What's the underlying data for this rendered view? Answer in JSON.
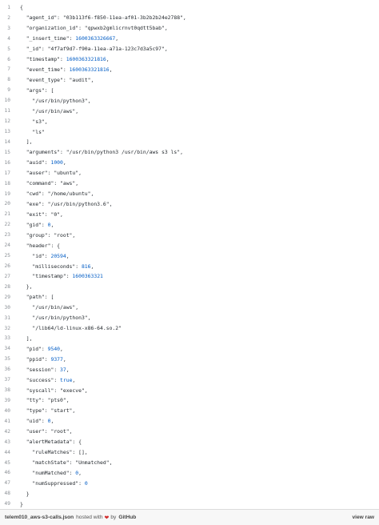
{
  "lines": [
    {
      "n": "1",
      "text": "{"
    },
    {
      "n": "2",
      "text": "  \"agent_id\": \"03b113f6-f850-11ea-af01-3b2b2b24e2788\","
    },
    {
      "n": "3",
      "text": "  \"organization_id\": \"qpwxb2gmlicrnvt0qdtt5bab\","
    },
    {
      "n": "4",
      "text": "  \"_insert_time\": 1600363326667,"
    },
    {
      "n": "5",
      "text": "  \"_id\": \"4f7af9d7-f90a-11ea-a71a-123c7d3a5c97\","
    },
    {
      "n": "6",
      "text": "  \"timestamp\": 1600363321816,"
    },
    {
      "n": "7",
      "text": "  \"event_time\": 1600363321816,"
    },
    {
      "n": "8",
      "text": "  \"event_type\": \"audit\","
    },
    {
      "n": "9",
      "text": "  \"args\": ["
    },
    {
      "n": "10",
      "text": "    \"/usr/bin/python3\","
    },
    {
      "n": "11",
      "text": "    \"/usr/bin/aws\","
    },
    {
      "n": "12",
      "text": "    \"s3\","
    },
    {
      "n": "13",
      "text": "    \"ls\""
    },
    {
      "n": "14",
      "text": "  ],"
    },
    {
      "n": "15",
      "text": "  \"arguments\": \"/usr/bin/python3 /usr/bin/aws s3 ls\","
    },
    {
      "n": "16",
      "text": "  \"auid\": 1000,"
    },
    {
      "n": "17",
      "text": "  \"auser\": \"ubuntu\","
    },
    {
      "n": "18",
      "text": "  \"command\": \"aws\","
    },
    {
      "n": "19",
      "text": "  \"cwd\": \"/home/ubuntu\","
    },
    {
      "n": "20",
      "text": "  \"exe\": \"/usr/bin/python3.6\","
    },
    {
      "n": "21",
      "text": "  \"exit\": \"0\","
    },
    {
      "n": "22",
      "text": "  \"gid\": 0,"
    },
    {
      "n": "23",
      "text": "  \"group\": \"root\","
    },
    {
      "n": "24",
      "text": "  \"header\": {"
    },
    {
      "n": "25",
      "text": "    \"id\": 20594,"
    },
    {
      "n": "26",
      "text": "    \"milliseconds\": 816,"
    },
    {
      "n": "27",
      "text": "    \"timestamp\": 1600363321"
    },
    {
      "n": "28",
      "text": "  },"
    },
    {
      "n": "29",
      "text": "  \"path\": ["
    },
    {
      "n": "30",
      "text": "    \"/usr/bin/aws\","
    },
    {
      "n": "31",
      "text": "    \"/usr/bin/python3\","
    },
    {
      "n": "32",
      "text": "    \"/lib64/ld-linux-x86-64.so.2\""
    },
    {
      "n": "33",
      "text": "  ],"
    },
    {
      "n": "34",
      "text": "  \"pid\": 9540,"
    },
    {
      "n": "35",
      "text": "  \"ppid\": 9377,"
    },
    {
      "n": "36",
      "text": "  \"session\": 37,"
    },
    {
      "n": "37",
      "text": "  \"success\": true,"
    },
    {
      "n": "38",
      "text": "  \"syscall\": \"execve\","
    },
    {
      "n": "39",
      "text": "  \"tty\": \"pts0\","
    },
    {
      "n": "40",
      "text": "  \"type\": \"start\","
    },
    {
      "n": "41",
      "text": "  \"uid\": 0,"
    },
    {
      "n": "42",
      "text": "  \"user\": \"root\","
    },
    {
      "n": "43",
      "text": "  \"alertMetadata\": {"
    },
    {
      "n": "44",
      "text": "    \"ruleMatches\": [],"
    },
    {
      "n": "45",
      "text": "    \"matchState\": \"Unmatched\","
    },
    {
      "n": "46",
      "text": "    \"numMatched\": 0,"
    },
    {
      "n": "47",
      "text": "    \"numSuppressed\": 0"
    },
    {
      "n": "48",
      "text": "  }"
    },
    {
      "n": "49",
      "text": "}"
    }
  ],
  "footer": {
    "file_name": "telem010_aws-s3-calls.json",
    "hosted_with": "hosted with",
    "heart_icon": "heart-icon",
    "by": "by",
    "github": "GitHub",
    "view_raw": "view raw"
  },
  "colors": {
    "number": "#005cc5",
    "text": "#24292e",
    "line_number": "#8a8f95",
    "footer_bg": "#f7f7f7",
    "heart": "#d12a2a"
  }
}
